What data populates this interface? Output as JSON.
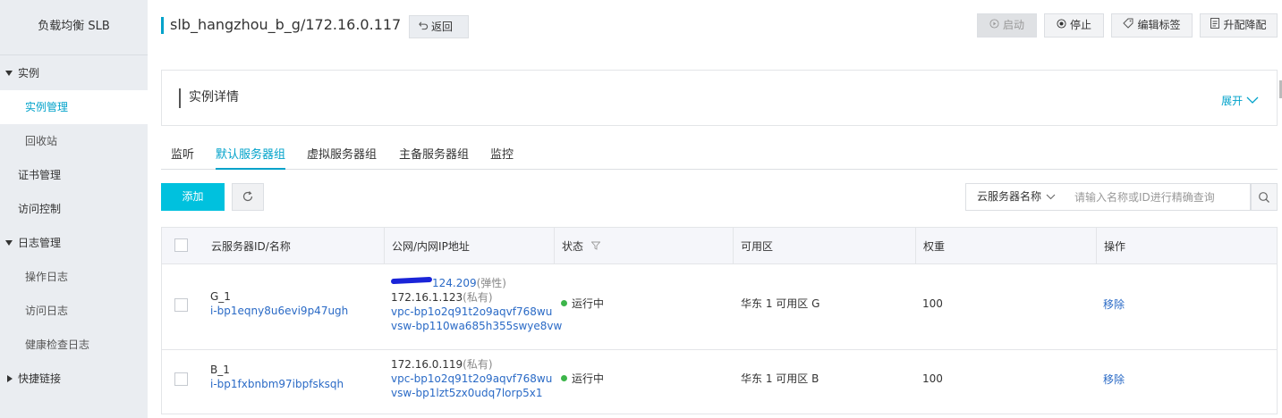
{
  "sidebar": {
    "title": "负载均衡 SLB",
    "instances_group": "实例",
    "instance_management": "实例管理",
    "recycle_bin": "回收站",
    "certificate_management": "证书管理",
    "access_control": "访问控制",
    "log_management": "日志管理",
    "operation_log": "操作日志",
    "access_log": "访问日志",
    "health_check_log": "健康检查日志",
    "quick_links": "快捷链接"
  },
  "header": {
    "title": "slb_hangzhou_b_g/172.16.0.117",
    "back_label": "返回",
    "start_label": "启动",
    "stop_label": "停止",
    "edit_tags_label": "编辑标签",
    "upgrade_label": "升配降配"
  },
  "detail": {
    "title": "实例详情",
    "expand_label": "展开"
  },
  "tabs": [
    "监听",
    "默认服务器组",
    "虚拟服务器组",
    "主备服务器组",
    "监控"
  ],
  "active_tab": "默认服务器组",
  "toolbar": {
    "add_label": "添加",
    "filter_label": "云服务器名称",
    "search_placeholder": "请输入名称或ID进行精确查询"
  },
  "table": {
    "headers": [
      "云服务器ID/名称",
      "公网/内网IP地址",
      "状态",
      "可用区",
      "权重",
      "操作"
    ],
    "rows": [
      {
        "name": "G_1",
        "id": "i-bp1eqny8u6evi9p47ugh",
        "public_ip_suffix": "124.209",
        "public_ip_tag": "(弹性)",
        "private_ip": "172.16.1.123",
        "private_ip_tag": "(私有)",
        "vpc": "vpc-bp1o2q91t2o9aqvf768wu",
        "vswitch": "vsw-bp110wa685h355swye8vw",
        "status": "运行中",
        "zone": "华东 1 可用区 G",
        "weight": "100",
        "action": "移除"
      },
      {
        "name": "B_1",
        "id": "i-bp1fxbnbm97ibpfsksqh",
        "private_ip": "172.16.0.119",
        "private_ip_tag": "(私有)",
        "vpc": "vpc-bp1o2q91t2o9aqvf768wu",
        "vswitch": "vsw-bp1lzt5zx0udq7lorp5x1",
        "status": "运行中",
        "zone": "华东 1 可用区 B",
        "weight": "100",
        "action": "移除"
      }
    ]
  },
  "colors": {
    "accent": "#00a2ca",
    "primary_button": "#00c1de",
    "link": "#2a6ac6",
    "status_running": "#3cb54a"
  }
}
